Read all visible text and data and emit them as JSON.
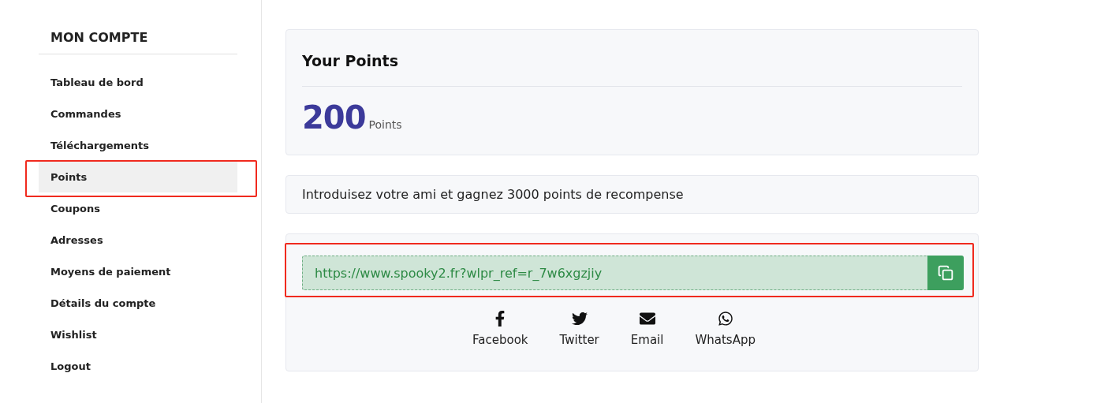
{
  "sidebar": {
    "title": "MON COMPTE",
    "items": [
      {
        "label": "Tableau de bord",
        "selected": false,
        "highlighted": false
      },
      {
        "label": "Commandes",
        "selected": false,
        "highlighted": false
      },
      {
        "label": "Téléchargements",
        "selected": false,
        "highlighted": false
      },
      {
        "label": "Points",
        "selected": true,
        "highlighted": true
      },
      {
        "label": "Coupons",
        "selected": false,
        "highlighted": false
      },
      {
        "label": "Adresses",
        "selected": false,
        "highlighted": false
      },
      {
        "label": "Moyens de paiement",
        "selected": false,
        "highlighted": false
      },
      {
        "label": "Détails du compte",
        "selected": false,
        "highlighted": false
      },
      {
        "label": "Wishlist",
        "selected": false,
        "highlighted": false
      },
      {
        "label": "Logout",
        "selected": false,
        "highlighted": false
      }
    ]
  },
  "points_card": {
    "title": "Your Points",
    "value": "200",
    "unit": "Points"
  },
  "referral_note": "Introduisez votre ami et gagnez 3000 points de recompense",
  "referral_link": {
    "value": "https://www.spooky2.fr?wlpr_ref=r_7w6xgzjiy",
    "highlighted": true
  },
  "share": [
    {
      "kind": "facebook",
      "label": "Facebook"
    },
    {
      "kind": "twitter",
      "label": "Twitter"
    },
    {
      "kind": "email",
      "label": "Email"
    },
    {
      "kind": "whatsapp",
      "label": "WhatsApp"
    }
  ]
}
